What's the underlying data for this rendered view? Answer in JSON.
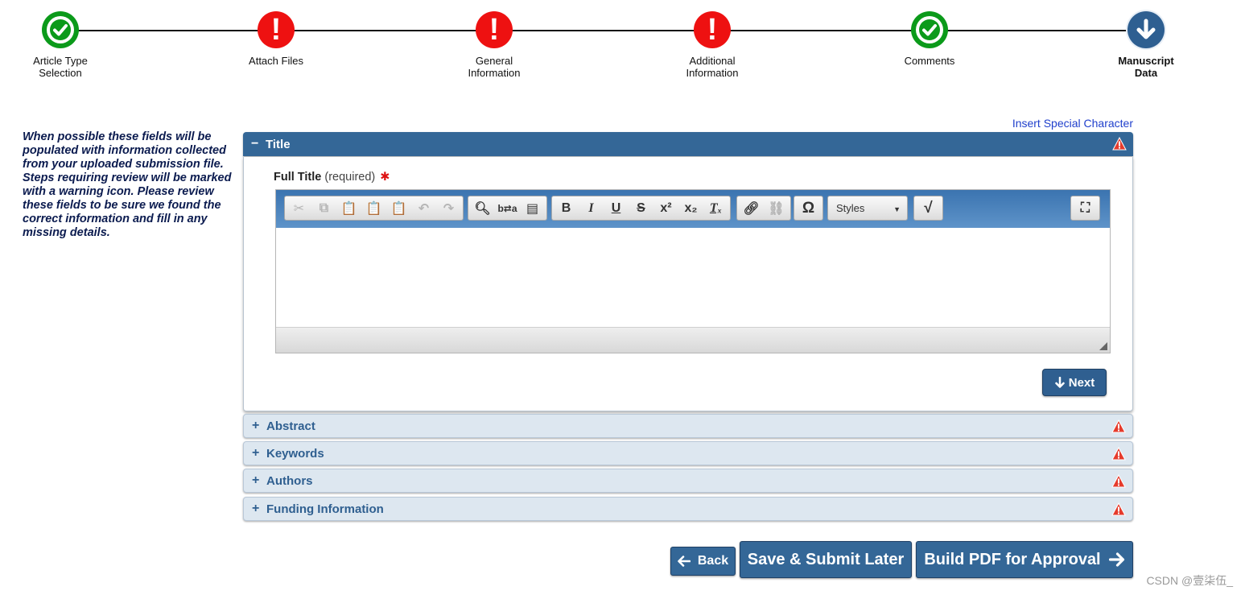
{
  "steps": [
    {
      "label": "Article Type Selection",
      "status": "complete"
    },
    {
      "label": "Attach Files",
      "status": "error"
    },
    {
      "label": "General Information",
      "status": "error"
    },
    {
      "label": "Additional Information",
      "status": "error"
    },
    {
      "label": "Comments",
      "status": "complete"
    },
    {
      "label": "Manuscript Data",
      "status": "current"
    }
  ],
  "colors": {
    "complete": "#0b9a1a",
    "error": "#ee1111",
    "current": "#2e5f91",
    "accent": "#346797"
  },
  "intro_text": "When possible these fields will be populated with information collected from your uploaded submission file. Steps requiring review will be marked with a warning icon. Please review these fields to be sure we found the correct information and fill in any missing details.",
  "insert_special_character": "Insert Special Character",
  "sections": {
    "title": {
      "sign": "−",
      "label": "Title"
    },
    "abstract": {
      "sign": "+",
      "label": "Abstract"
    },
    "keywords": {
      "sign": "+",
      "label": "Keywords"
    },
    "authors": {
      "sign": "+",
      "label": "Authors"
    },
    "funding": {
      "sign": "+",
      "label": "Funding Information"
    }
  },
  "title_field": {
    "label": "Full Title",
    "required_text": "(required)",
    "required_mark": "✱",
    "value": ""
  },
  "editor": {
    "styles_label": "Styles",
    "toolbar_icons": [
      "cut-icon",
      "copy-icon",
      "paste-icon",
      "paste-text-icon",
      "paste-word-icon",
      "undo-icon",
      "redo-icon",
      "find-icon",
      "replace-icon",
      "select-all-icon",
      "bold-icon",
      "italic-icon",
      "underline-icon",
      "strikethrough-icon",
      "superscript-icon",
      "subscript-icon",
      "remove-format-icon",
      "link-icon",
      "unlink-icon",
      "special-char-icon",
      "math-icon",
      "maximize-icon"
    ]
  },
  "next_label": "Next",
  "buttons": {
    "back": "Back",
    "save_later": "Save & Submit Later",
    "build_pdf": "Build PDF for Approval"
  },
  "watermark": "CSDN @壹柒伍_"
}
